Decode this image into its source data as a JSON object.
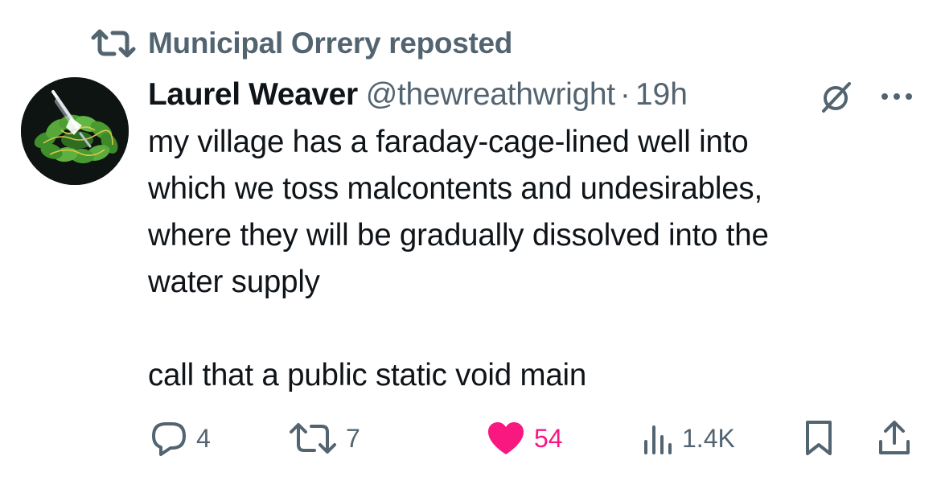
{
  "repost": {
    "text": "Municipal Orrery reposted",
    "icon": "repost-icon"
  },
  "author": {
    "display_name": "Laurel Weaver",
    "handle": "@thewreathwright",
    "separator": "·",
    "time": "19h",
    "avatar": "wreath-avatar"
  },
  "tweet": {
    "lines": [
      "my village has a faraday-cage-lined well into",
      "which we toss malcontents and undesirables,",
      "where they will be gradually dissolved into the",
      "water supply",
      "call that a public static void main"
    ]
  },
  "actions": {
    "reply": {
      "icon": "reply-icon",
      "count": "4"
    },
    "repost": {
      "icon": "repost-icon",
      "count": "7"
    },
    "like": {
      "icon": "heart-icon",
      "count": "54",
      "active": true,
      "color": "#f91880"
    },
    "views": {
      "icon": "views-icon",
      "count": "1.4K"
    },
    "bookmark": {
      "icon": "bookmark-icon"
    },
    "share": {
      "icon": "share-icon"
    }
  },
  "colors": {
    "text": "#0f1419",
    "secondary": "#536471",
    "like": "#f91880",
    "background": "#ffffff"
  }
}
